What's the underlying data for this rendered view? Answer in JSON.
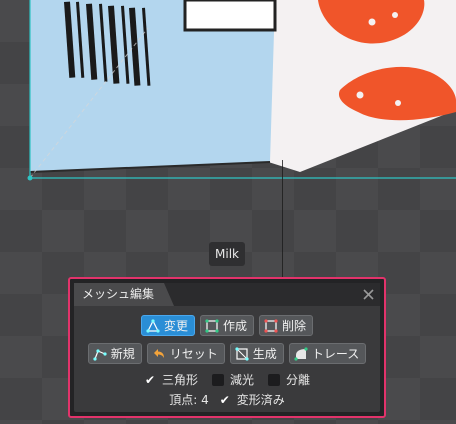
{
  "canvas": {
    "label": "Milk"
  },
  "panel": {
    "title": "メッシュ編集",
    "close_icon": "close-icon",
    "row1": [
      {
        "label": "変更",
        "icon": "mesh-edit-icon",
        "active": true
      },
      {
        "label": "作成",
        "icon": "mesh-create-icon",
        "active": false
      },
      {
        "label": "削除",
        "icon": "mesh-delete-icon",
        "active": false
      }
    ],
    "row2": [
      {
        "label": "新規",
        "icon": "new-mesh-icon"
      },
      {
        "label": "リセット",
        "icon": "undo-icon"
      },
      {
        "label": "生成",
        "icon": "generate-icon"
      },
      {
        "label": "トレース",
        "icon": "trace-icon"
      }
    ],
    "options": {
      "triangle": {
        "label": "三角形",
        "checked": true
      },
      "reduce": {
        "label": "減光",
        "checked": false
      },
      "split": {
        "label": "分離",
        "checked": false
      },
      "deformed": {
        "label": "変形済み",
        "checked": true
      }
    },
    "vertices_label": "頂点: 4"
  },
  "colors": {
    "accent": "#2a8ed6",
    "panel_border": "#e2336b",
    "selection": "#2ec4c4"
  }
}
